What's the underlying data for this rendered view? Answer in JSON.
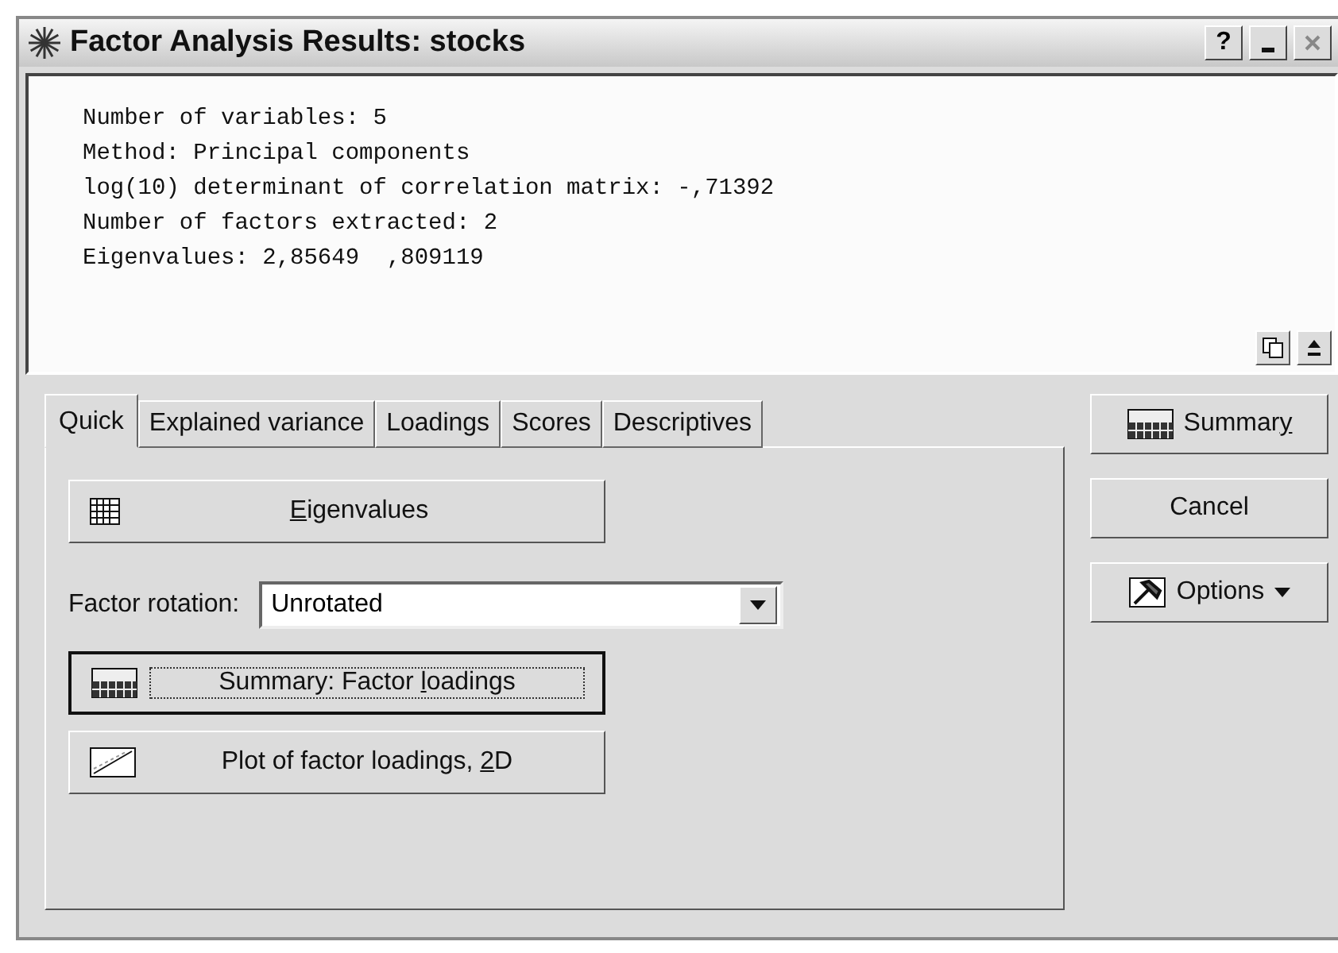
{
  "window": {
    "title": "Factor Analysis Results: stocks",
    "controls": [
      "?"
    ]
  },
  "output": {
    "lines": [
      "Number of variables: 5",
      "Method: Principal components",
      "log(10) determinant of correlation matrix: -,71392",
      "Number of factors extracted: 2",
      "Eigenvalues: 2,85649  ,809119"
    ]
  },
  "tabs": [
    {
      "label": "Quick",
      "selected": true
    },
    {
      "label": "Explained variance",
      "selected": false
    },
    {
      "label": "Loadings",
      "selected": false
    },
    {
      "label": "Scores",
      "selected": false
    },
    {
      "label": "Descriptives",
      "selected": false
    }
  ],
  "quick": {
    "buttons": [
      {
        "kind": "grid",
        "label": {
          "key": "E",
          "post": "igenvalues"
        },
        "focused": false
      }
    ],
    "rotation": {
      "label": "Factor rotation:",
      "value": "Unrotated"
    },
    "actions": [
      {
        "kind": "summary",
        "label": {
          "pre": "Summary: Factor ",
          "key": "l",
          "post": "oadings"
        },
        "focused": true
      },
      {
        "kind": "plot",
        "label": {
          "pre": "Plot of factor loadings, ",
          "key": "2",
          "post": "D"
        },
        "focused": false
      }
    ]
  },
  "side_buttons": [
    {
      "kind": "summary",
      "label": {
        "pre": "Summar",
        "key": "y"
      }
    },
    {
      "kind": "none",
      "label": {
        "pre": "Cancel"
      }
    },
    {
      "kind": "options",
      "label": {
        "pre": "Options"
      }
    }
  ]
}
